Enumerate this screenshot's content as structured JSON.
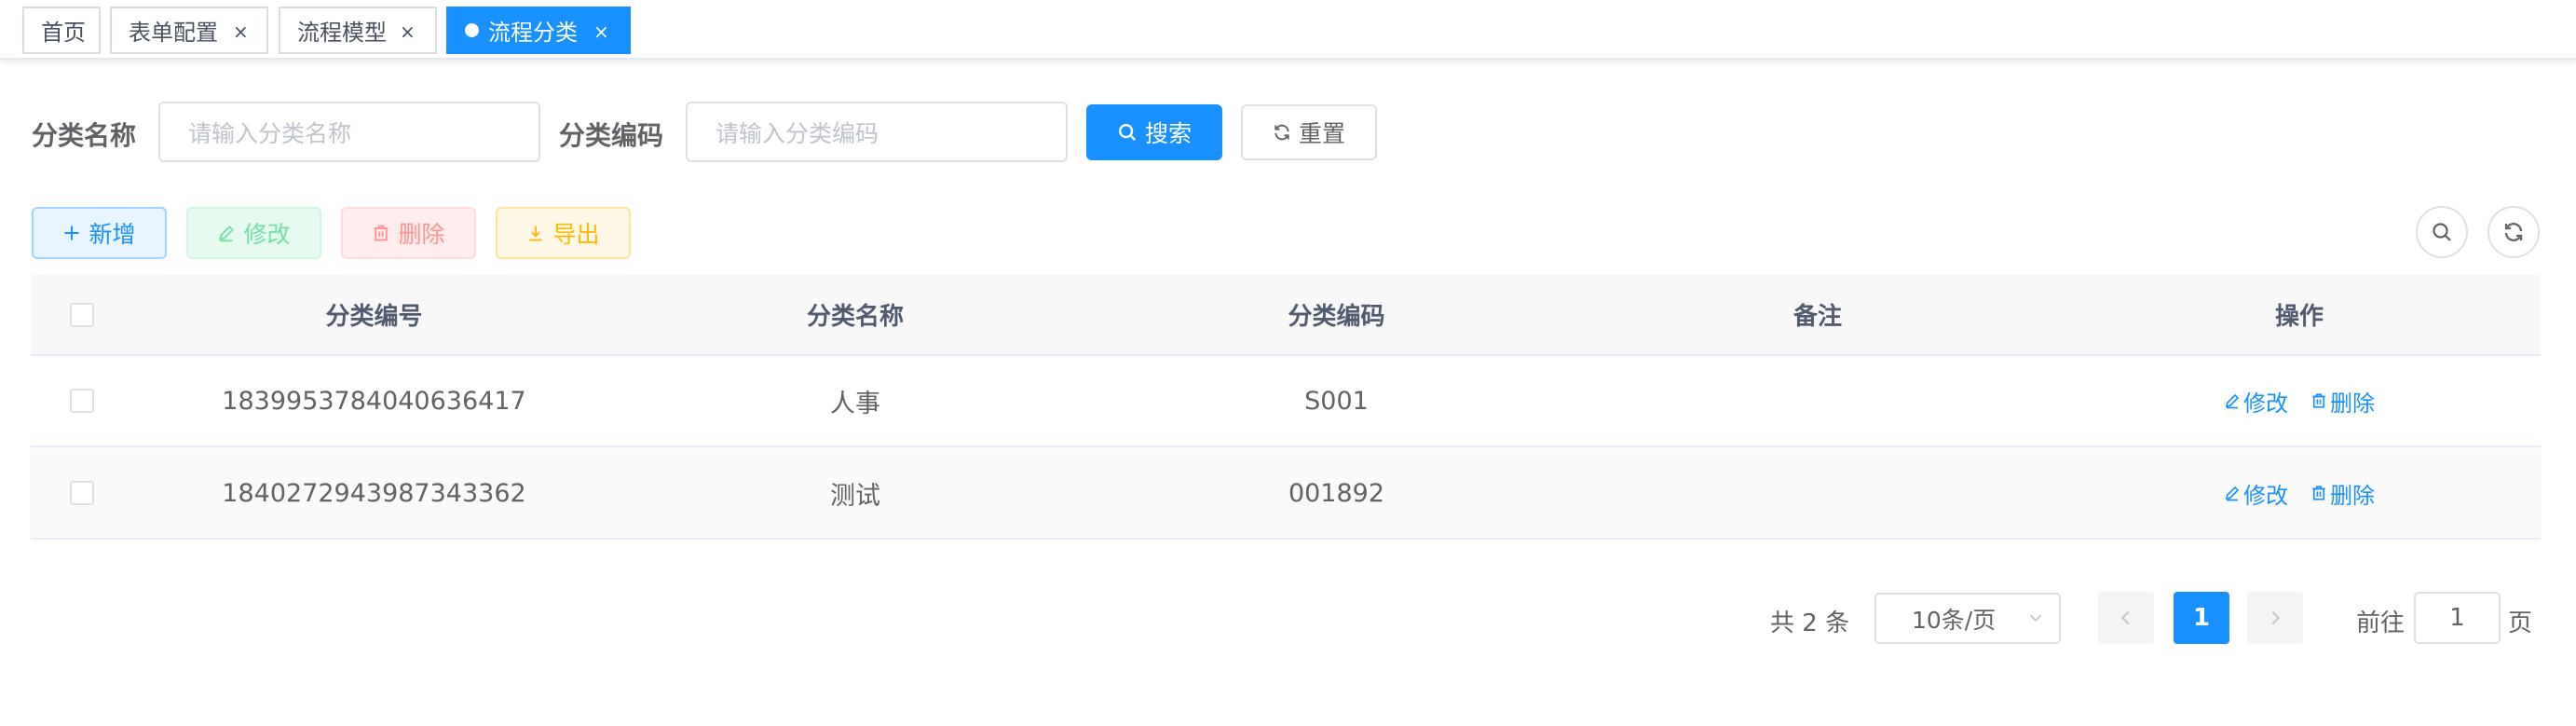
{
  "tabs": [
    {
      "label": "首页"
    },
    {
      "label": "表单配置",
      "close": "×"
    },
    {
      "label": "流程模型",
      "close": "×"
    },
    {
      "label": "流程分类",
      "close": "×",
      "active": true
    }
  ],
  "search": {
    "name_label": "分类名称",
    "name_placeholder": "请输入分类名称",
    "code_label": "分类编码",
    "code_placeholder": "请输入分类编码",
    "search_button": "搜索",
    "reset_button": "重置"
  },
  "toolbar": {
    "add_button": "新增",
    "edit_button": "修改",
    "delete_button": "删除",
    "export_button": "导出",
    "search_toggle_icon": "search-icon",
    "refresh_icon": "refresh-icon"
  },
  "table": {
    "headers": [
      "分类编号",
      "分类名称",
      "分类编码",
      "备注",
      "操作"
    ],
    "rows": [
      {
        "id": "1839953784040636417",
        "name": "人事",
        "code": "S001",
        "remark": "",
        "edit": "修改",
        "delete": "删除"
      },
      {
        "id": "1840272943987343362",
        "name": "测试",
        "code": "001892",
        "remark": "",
        "edit": "修改",
        "delete": "删除"
      }
    ]
  },
  "pagination": {
    "total_text": "共 2 条",
    "page_size": "10条/页",
    "current_page": "1",
    "goto_prefix": "前往",
    "goto_value": "1",
    "goto_suffix": "页"
  },
  "colors": {
    "primary": "#1890ff",
    "success": "#71e2a3",
    "danger": "#ff9292",
    "warning": "#ffba00"
  }
}
